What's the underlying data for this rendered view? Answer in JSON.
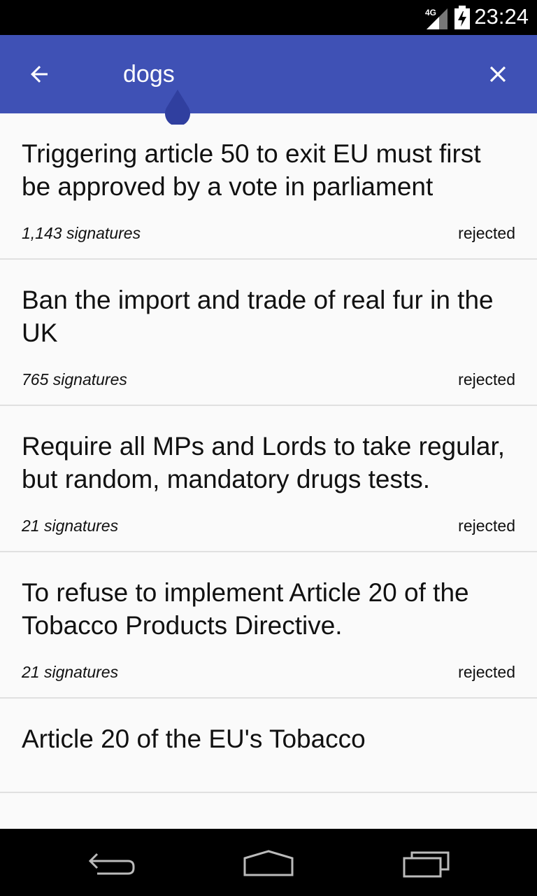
{
  "status_bar": {
    "time": "23:24",
    "network": "4G",
    "icons": [
      "signal-icon",
      "battery-charging-icon"
    ]
  },
  "toolbar": {
    "search_value": "dogs",
    "back_icon": "arrow-left-icon",
    "close_icon": "close-icon",
    "background_color": "#3f51b5"
  },
  "petitions": [
    {
      "title": "Triggering article 50 to exit EU must first be approved by a vote in parliament",
      "signatures": "1,143 signatures",
      "status": "rejected"
    },
    {
      "title": "Ban the import and trade of real fur in the UK",
      "signatures": "765 signatures",
      "status": "rejected"
    },
    {
      "title": "Require all MPs and Lords to take regular, but random, mandatory drugs tests.",
      "signatures": "21 signatures",
      "status": "rejected"
    },
    {
      "title": "To refuse to implement Article 20 of the Tobacco Products Directive.",
      "signatures": "21 signatures",
      "status": "rejected"
    },
    {
      "title": "Article 20 of the EU's Tobacco",
      "signatures": "",
      "status": ""
    }
  ],
  "nav_bar": {
    "back": "back-icon",
    "home": "home-icon",
    "recents": "recents-icon"
  }
}
